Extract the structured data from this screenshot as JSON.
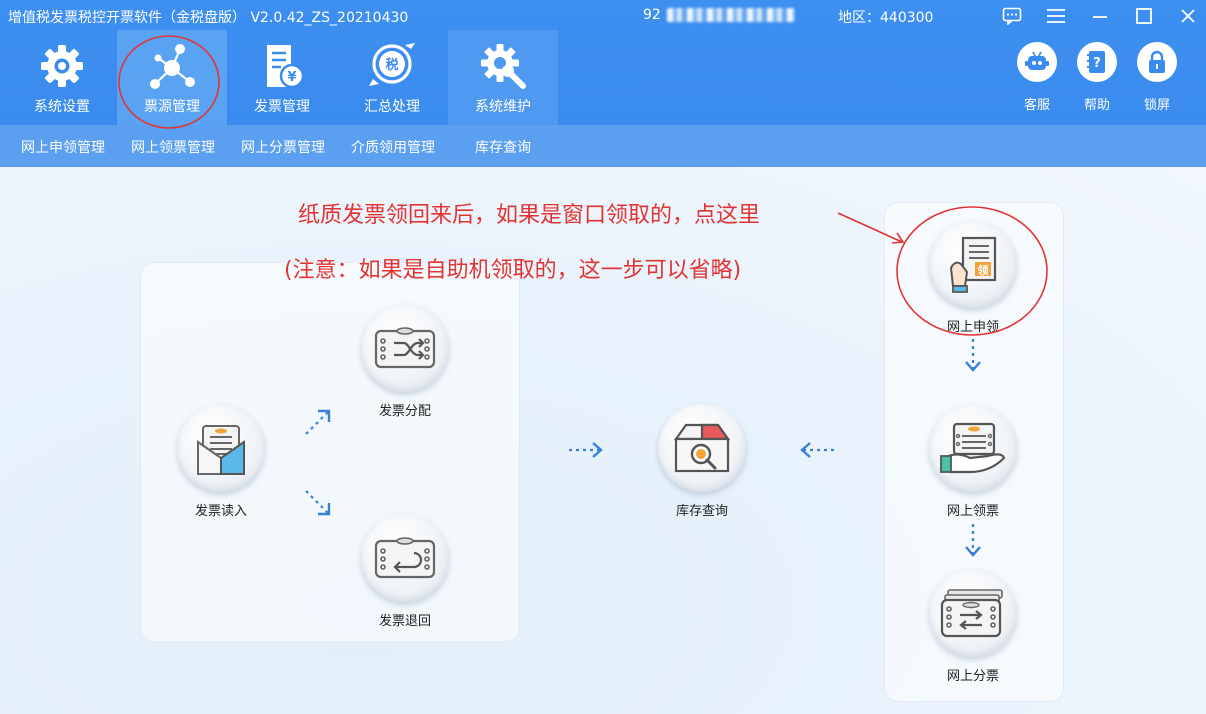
{
  "window": {
    "title": "增值税发票税控开票软件（金税盘版） V2.0.42_ZS_20210430",
    "account_prefix": "92",
    "region_label": "地区：440300"
  },
  "nav": {
    "items": [
      {
        "label": "系统设置",
        "icon": "gear-icon"
      },
      {
        "label": "票源管理",
        "icon": "network-icon"
      },
      {
        "label": "发票管理",
        "icon": "invoice-icon"
      },
      {
        "label": "汇总处理",
        "icon": "tax-summary-icon"
      },
      {
        "label": "系统维护",
        "icon": "wrench-gear-icon"
      }
    ],
    "active_index": 1
  },
  "right_tools": [
    {
      "label": "客服",
      "icon": "robot-icon"
    },
    {
      "label": "帮助",
      "icon": "help-book-icon"
    },
    {
      "label": "锁屏",
      "icon": "lock-icon"
    }
  ],
  "subnav": [
    {
      "label": "网上申领管理"
    },
    {
      "label": "网上领票管理"
    },
    {
      "label": "网上分票管理"
    },
    {
      "label": "介质领用管理"
    },
    {
      "label": "库存查询"
    }
  ],
  "flow": {
    "read": "发票读入",
    "distribute": "发票分配",
    "return": "发票退回",
    "inventory": "库存查询",
    "apply": "网上申领",
    "receive": "网上领票",
    "split": "网上分票"
  },
  "annotation": {
    "line1": "纸质发票领回来后，如果是窗口领取的，点这里",
    "line2": "(注意：如果是自助机领取的，这一步可以省略)"
  },
  "colors": {
    "toolbar_blue": "#3a8bee",
    "subbar_blue": "#5a9ff0",
    "annotation_red": "#e23434",
    "arrow_blue": "#3a7fd8"
  }
}
